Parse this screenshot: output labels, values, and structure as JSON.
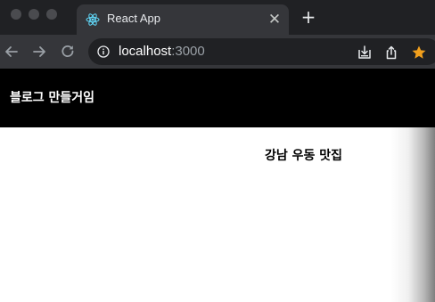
{
  "browser": {
    "tab": {
      "title": "React App",
      "favicon": "react-logo-icon",
      "close_glyph": "✕"
    },
    "new_tab_glyph": "+",
    "toolbar": {
      "url_host": "localhost",
      "url_port": ":3000"
    },
    "colors": {
      "tab_strip": "#202124",
      "toolbar": "#35363a",
      "omnibox": "#202124",
      "star": "#f2a01d"
    }
  },
  "page": {
    "nav": {
      "logo": "블로그 만들거임",
      "background": "#000000"
    },
    "list": {
      "item_title": "강남 우동 맛집"
    }
  }
}
